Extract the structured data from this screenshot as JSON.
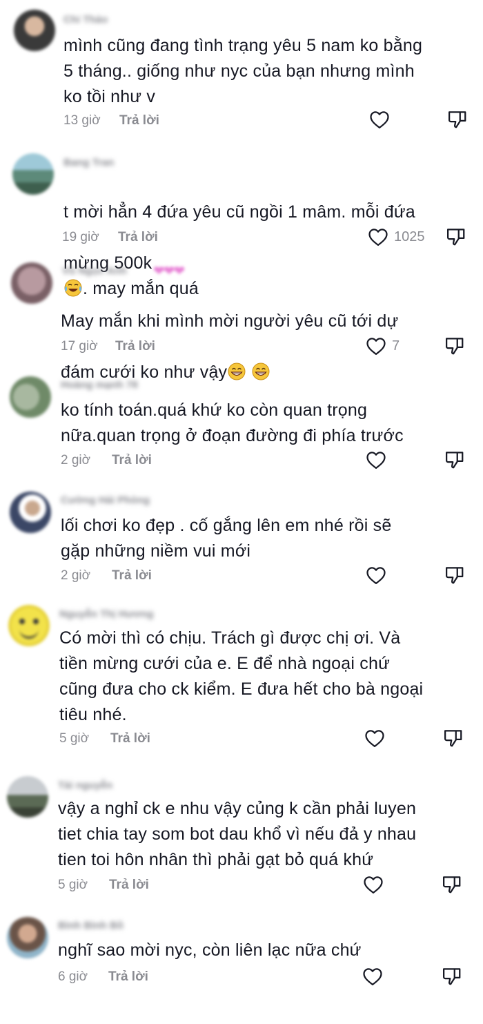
{
  "colors": {
    "text": "#161823",
    "muted": "#8a8b91",
    "background": "#ffffff"
  },
  "comments": [
    {
      "username": "Chi Thảo",
      "text": "mình cũng đang tình trạng yêu 5 nam ko bằng\n5 tháng.. giống như nyc của bạn nhưng mình\nko tồi như v",
      "time": "13 giờ",
      "reply": "Trả lời",
      "likes": ""
    },
    {
      "username": "Bang Tran",
      "text_line1": "t mời hẳn 4 đứa yêu cũ ngồi 1 mâm. mỗi đứa",
      "text_line2a": "mừng 500k",
      "text_line2b": ". may mắn quá",
      "time": "19 giờ",
      "reply": "Trả lời",
      "likes": "1025"
    },
    {
      "username": "Vũ Ngọc Anh",
      "text_line1": "May mắn khi mình mời người yêu cũ tới dự",
      "text_line2a": "đám cưới ko như vậy",
      "time": "17 giờ",
      "reply": "Trả lời",
      "likes": "7"
    },
    {
      "username": "Hoàng mạnh 78",
      "text": "ko tính toán.quá khứ ko còn quan trọng\nnữa.quan trọng ở đoạn đường đi phía trước",
      "time": "2 giờ",
      "reply": "Trả lời",
      "likes": ""
    },
    {
      "username": "Cường Hải Phòng",
      "text": "lối chơi ko đẹp . cố gắng lên em nhé rồi sẽ\ngặp những niềm vui mới",
      "time": "2 giờ",
      "reply": "Trả lời",
      "likes": ""
    },
    {
      "username": "Nguyễn Thị Hương",
      "text": "Có mời thì có chịu. Trách gì được chị ơi. Và\ntiền mừng cưới của e. E để nhà ngoại chứ\ncũng đưa cho ck kiểm. E đưa hết cho bà ngoại\ntiêu nhé.",
      "time": "5 giờ",
      "reply": "Trả lời",
      "likes": ""
    },
    {
      "username": "Tài nguyễn",
      "text": "vậy a nghỉ ck e nhu vậy củng k cần phải luyen\ntiet chia tay som bot dau khổ vì nếu đả y nhau\ntien toi hôn nhân thì phải gạt bỏ quá khứ",
      "time": "5 giờ",
      "reply": "Trả lời",
      "likes": ""
    },
    {
      "username": "Bình Bình Bồ",
      "text": "nghĩ sao mời nyc, còn liên lạc nữa chứ",
      "time": "6 giờ",
      "reply": "Trả lời",
      "likes": ""
    }
  ]
}
